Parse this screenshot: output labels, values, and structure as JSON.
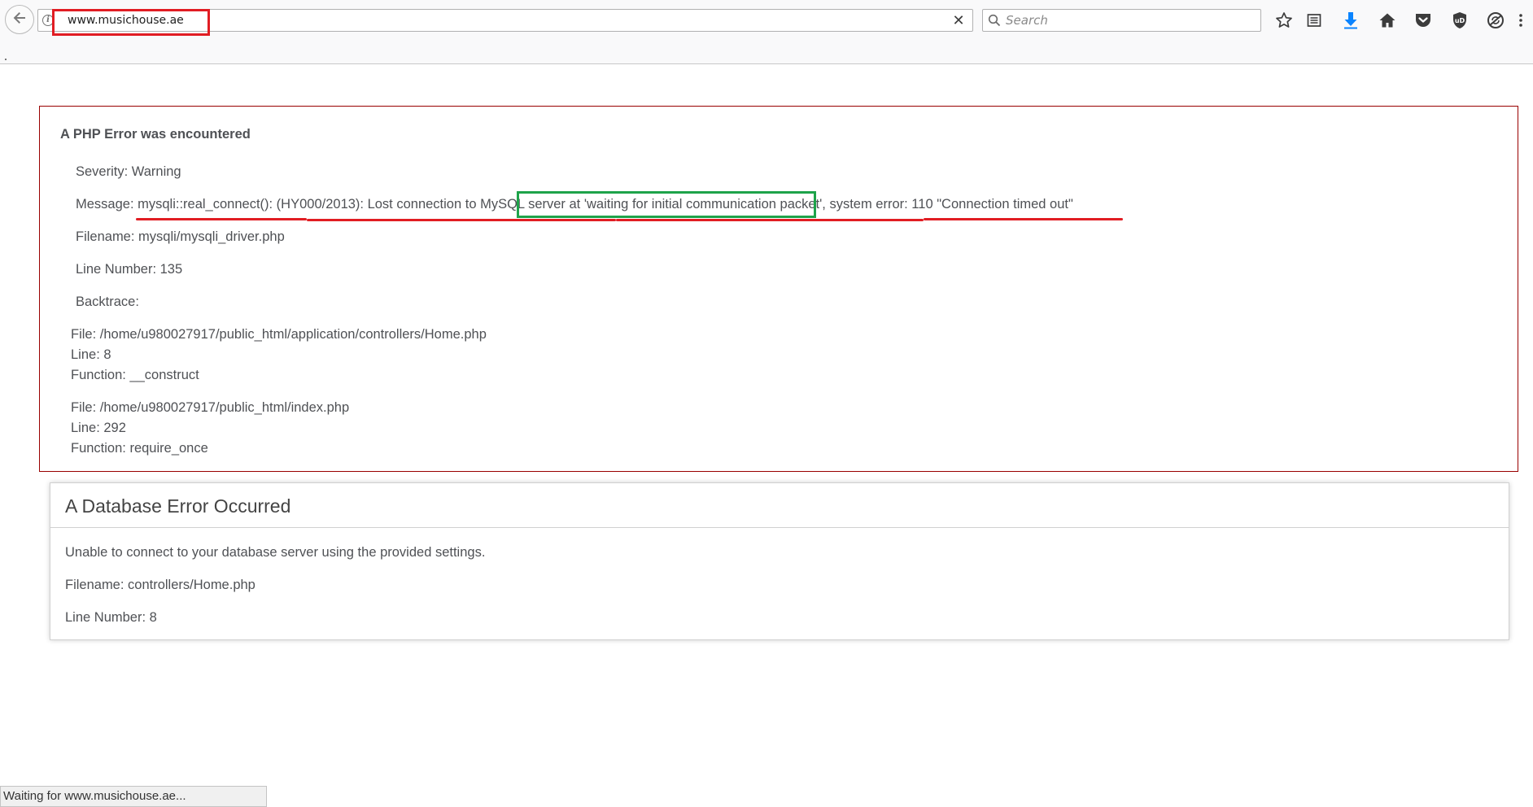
{
  "browser": {
    "url": "www.musichouse.ae",
    "search_placeholder": "Search",
    "status": "Waiting for www.musichouse.ae...",
    "icons": [
      "back-arrow-icon",
      "info-icon",
      "clear-icon",
      "search-icon",
      "bookmark-star-icon",
      "reading-list-icon",
      "download-icon",
      "home-icon",
      "pocket-icon",
      "ublock-icon",
      "sync-icon",
      "menu-icon"
    ],
    "accent": "#0a84ff"
  },
  "php_error": {
    "title": "A PHP Error was encountered",
    "severity": "Severity: Warning",
    "message_prefix": "Message: ",
    "message_part1": "mysqli::real_connect(): (HY000/2013): Lost connection to MySQL ",
    "message_highlight": "server at 'waiting for initial communication packet'",
    "message_part2": ", system error: 110 \"Connection timed out\"",
    "filename": "Filename: mysqli/mysqli_driver.php",
    "line_number": "Line Number: 135",
    "backtrace_label": "Backtrace:",
    "backtrace": [
      {
        "file": "File: /home/u980027917/public_html/application/controllers/Home.php",
        "line": "Line: 8",
        "function": "Function: __construct"
      },
      {
        "file": "File: /home/u980027917/public_html/index.php",
        "line": "Line: 292",
        "function": "Function: require_once"
      }
    ],
    "border_color": "#990000"
  },
  "db_error": {
    "heading": "A Database Error Occurred",
    "message": "Unable to connect to your database server using the provided settings.",
    "filename": "Filename: controllers/Home.php",
    "line_number": "Line Number: 8"
  },
  "annotations": {
    "red": "#e11d23",
    "green": "#1ea34a"
  }
}
